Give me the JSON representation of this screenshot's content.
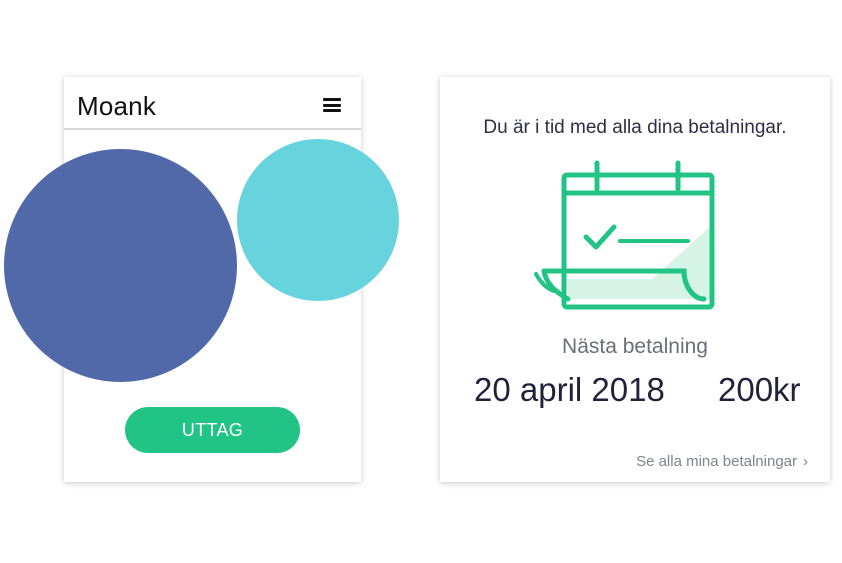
{
  "left_card": {
    "logo": "Moank",
    "menu_icon": "hamburger-icon",
    "button_label": "UTTAG",
    "button_color": "#22c486"
  },
  "decor": {
    "circle_blue_color": "#5169a9",
    "circle_cyan_color": "#67d3dd"
  },
  "right_card": {
    "status_text": "Du är i tid med alla dina betalningar.",
    "calendar_icon": "calendar-check-icon",
    "icon_color": "#22c486",
    "next_payment_label": "Nästa betalning",
    "next_payment_date": "20 april 2018",
    "next_payment_amount": "200kr",
    "see_all_link": "Se alla mina betalningar",
    "chevron_icon": "chevron-right-icon"
  }
}
